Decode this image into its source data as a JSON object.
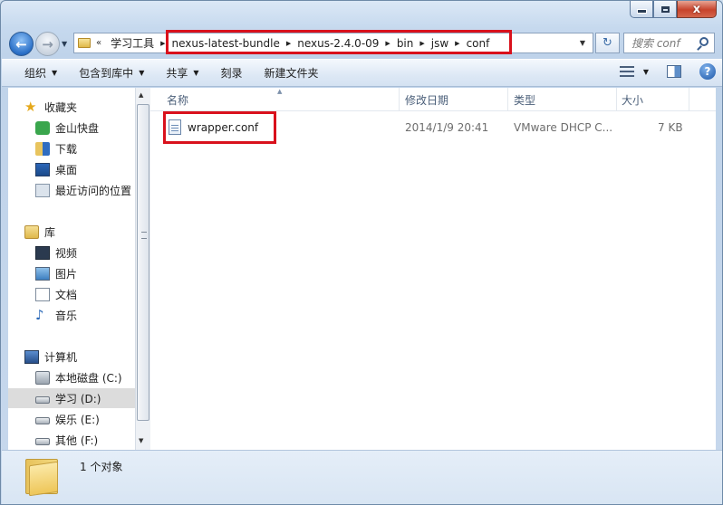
{
  "window": {
    "caption": {
      "minimize": "",
      "maximize": "",
      "close": "x"
    }
  },
  "nav": {
    "back_glyph": "←",
    "forward_glyph": "→",
    "history_dropdown": "▼"
  },
  "address": {
    "overflow_chevron": "«",
    "crumbs": [
      "学习工具",
      "nexus-latest-bundle",
      "nexus-2.4.0-09",
      "bin",
      "jsw",
      "conf"
    ],
    "separator": "▶",
    "dropdown": "▼",
    "refresh_glyph": "↻"
  },
  "search": {
    "placeholder": "搜索 conf"
  },
  "toolbar": {
    "organize": "组织",
    "include_in_library": "包含到库中",
    "share": "共享",
    "burn": "刻录",
    "new_folder": "新建文件夹",
    "dropdown_glyph": "▼",
    "help": "?"
  },
  "sidebar": {
    "favorites_header": "收藏夹",
    "favorites": [
      "金山快盘",
      "下载",
      "桌面",
      "最近访问的位置"
    ],
    "libraries_header": "库",
    "libraries": [
      "视频",
      "图片",
      "文档",
      "音乐"
    ],
    "computer_header": "计算机",
    "drives": [
      "本地磁盘 (C:)",
      "学习 (D:)",
      "娱乐 (E:)",
      "其他 (F:)"
    ],
    "selected": "学习 (D:)"
  },
  "columns": {
    "name": "名称",
    "modified": "修改日期",
    "type": "类型",
    "size": "大小"
  },
  "files": [
    {
      "name": "wrapper.conf",
      "modified": "2014/1/9 20:41",
      "type": "VMware DHCP C...",
      "size": "7 KB"
    }
  ],
  "status": {
    "text": "1 个对象"
  },
  "colors": {
    "highlight": "#d9111c",
    "accent": "#2a6fc7"
  },
  "icons": {
    "favorites": "star-icon",
    "libraries": "library-icon",
    "computer": "computer-icon",
    "drive": "drive-icon",
    "file": "conf-file-icon",
    "folder": "folder-icon"
  }
}
